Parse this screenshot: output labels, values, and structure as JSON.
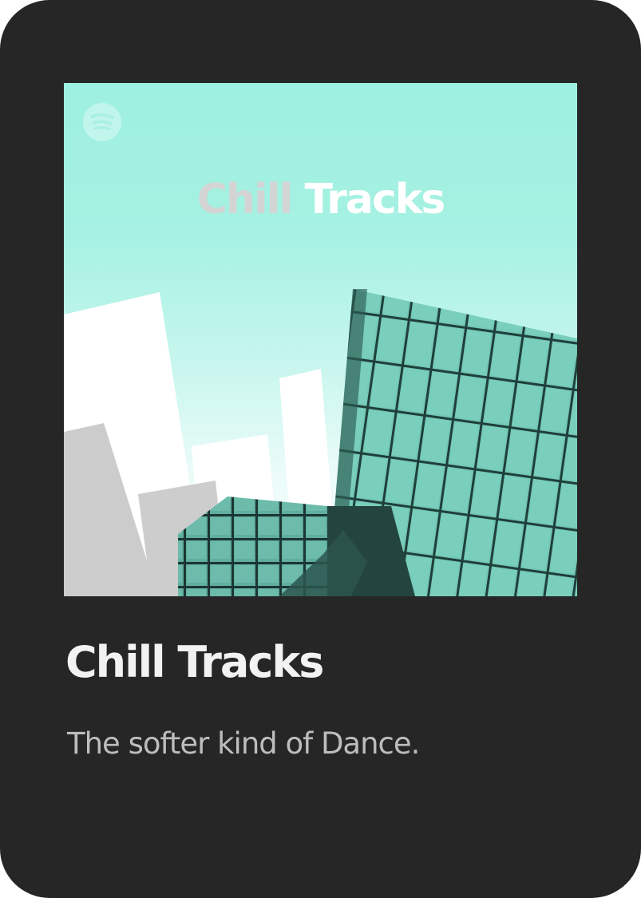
{
  "playlist": {
    "cover": {
      "title_word_1": "Chill",
      "title_word_2": "Tracks",
      "logo_icon": "spotify-icon"
    },
    "title": "Chill Tracks",
    "description": "The softer kind of Dance."
  },
  "colors": {
    "card_background": "#262626",
    "cover_sky": "#9ef0e0",
    "cover_glass": "#6ec4b2",
    "title_text": "#f2f2f2",
    "description_text": "#bdbdbd"
  }
}
